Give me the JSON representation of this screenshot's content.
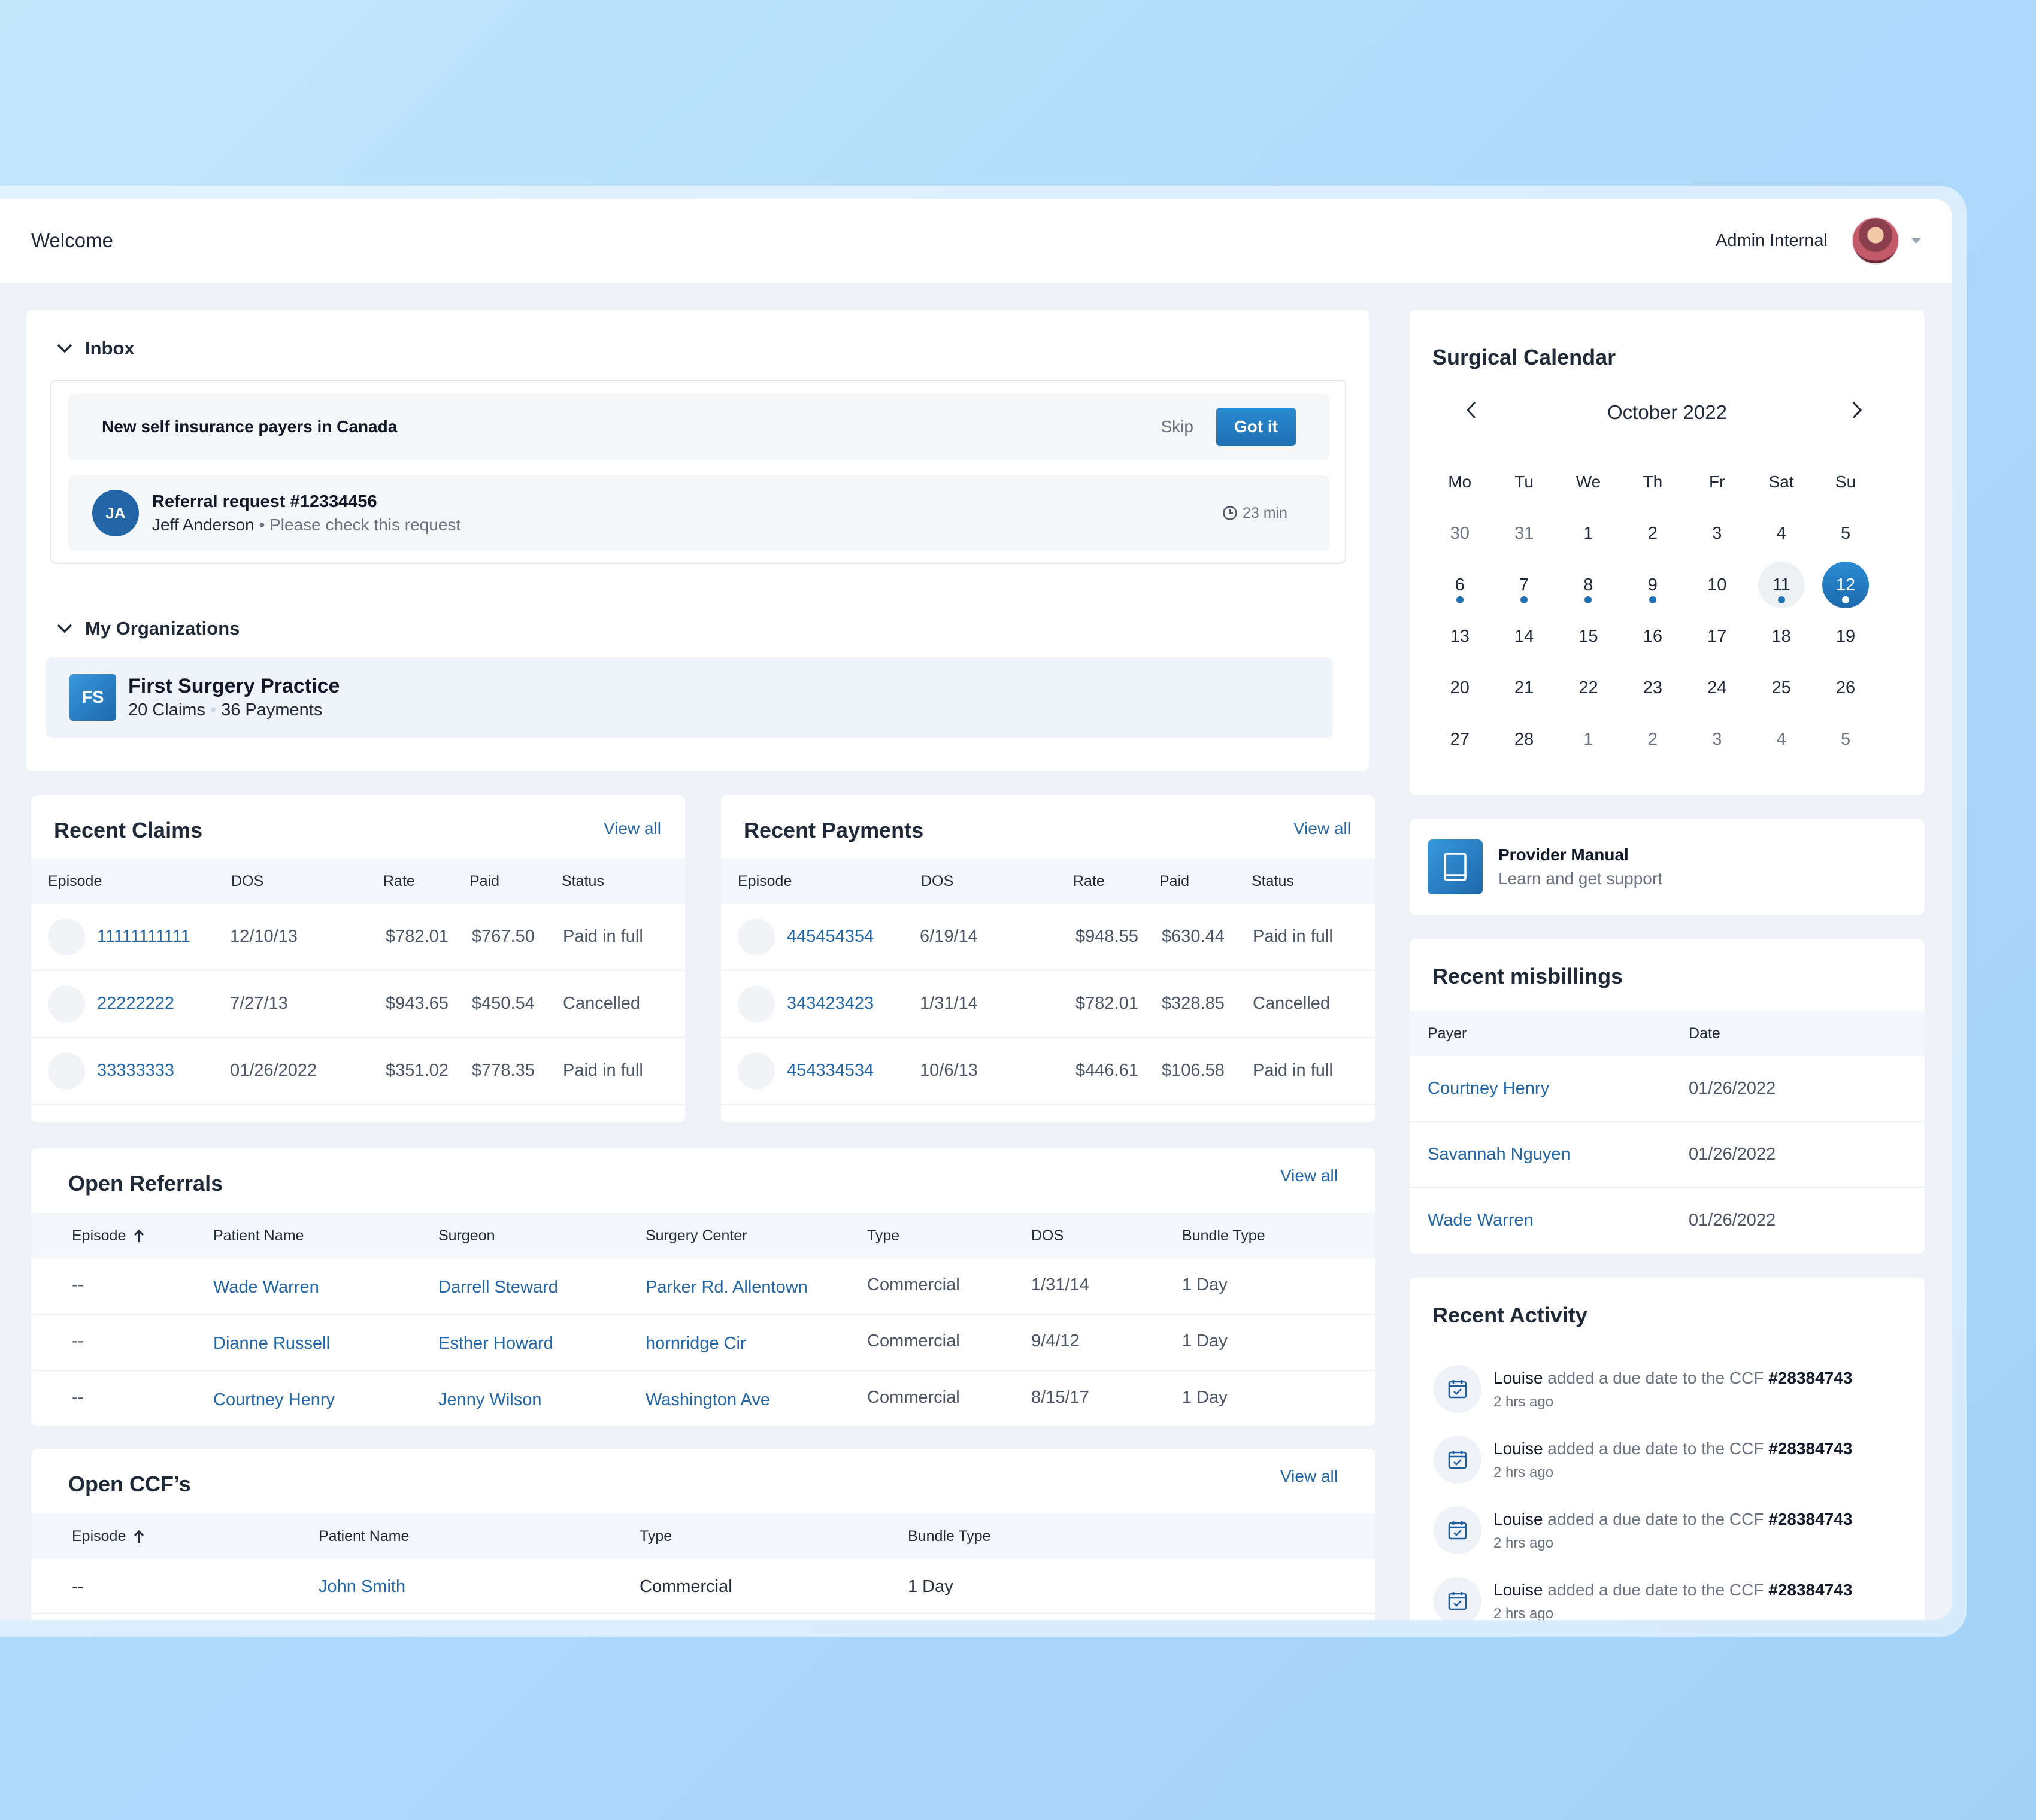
{
  "header": {
    "welcome": "Welcome",
    "user_name": "Admin Internal"
  },
  "inbox": {
    "title": "Inbox",
    "notice": {
      "text": "New self insurance payers in Canada",
      "skip": "Skip",
      "got_it": "Got it"
    },
    "request": {
      "initials": "JA",
      "title": "Referral request #12334456",
      "sender": "Jeff Anderson",
      "message": "• Please check this request",
      "time": "23 min"
    }
  },
  "organizations": {
    "title": "My Organizations",
    "org": {
      "initials": "FS",
      "name": "First Surgery Practice",
      "claims": "20 Claims",
      "sep": "•",
      "payments": "36 Payments"
    }
  },
  "recent_claims": {
    "title": "Recent Claims",
    "view_all": "View all",
    "columns": [
      "Episode",
      "DOS",
      "Rate",
      "Paid",
      "Status"
    ],
    "rows": [
      {
        "episode": "11111111111",
        "dos": "12/10/13",
        "rate": "$782.01",
        "paid": "$767.50",
        "status": "Paid in full"
      },
      {
        "episode": "22222222",
        "dos": "7/27/13",
        "rate": "$943.65",
        "paid": "$450.54",
        "status": "Cancelled"
      },
      {
        "episode": "33333333",
        "dos": "01/26/2022",
        "rate": "$351.02",
        "paid": "$778.35",
        "status": "Paid in full"
      }
    ]
  },
  "recent_payments": {
    "title": "Recent Payments",
    "view_all": "View all",
    "columns": [
      "Episode",
      "DOS",
      "Rate",
      "Paid",
      "Status"
    ],
    "rows": [
      {
        "episode": "445454354",
        "dos": "6/19/14",
        "rate": "$948.55",
        "paid": "$630.44",
        "status": "Paid in full"
      },
      {
        "episode": "343423423",
        "dos": "1/31/14",
        "rate": "$782.01",
        "paid": "$328.85",
        "status": "Cancelled"
      },
      {
        "episode": "454334534",
        "dos": "10/6/13",
        "rate": "$446.61",
        "paid": "$106.58",
        "status": "Paid in full"
      }
    ]
  },
  "open_referrals": {
    "title": "Open Referrals",
    "view_all": "View all",
    "columns": [
      "Episode",
      "Patient Name",
      "Surgeon",
      "Surgery Center",
      "Type",
      "DOS",
      "Bundle Type"
    ],
    "rows": [
      {
        "episode": "--",
        "patient": "Wade Warren",
        "surgeon": "Darrell Steward",
        "center": "Parker Rd. Allentown",
        "type": "Commercial",
        "dos": "1/31/14",
        "bundle": "1 Day"
      },
      {
        "episode": "--",
        "patient": "Dianne Russell",
        "surgeon": "Esther Howard",
        "center": "hornridge Cir",
        "type": "Commercial",
        "dos": "9/4/12",
        "bundle": "1 Day"
      },
      {
        "episode": "--",
        "patient": "Courtney Henry",
        "surgeon": "Jenny Wilson",
        "center": "Washington Ave",
        "type": "Commercial",
        "dos": "8/15/17",
        "bundle": "1 Day"
      }
    ]
  },
  "open_ccfs": {
    "title": "Open CCF’s",
    "view_all": "View all",
    "columns": [
      "Episode",
      "Patient Name",
      "Type",
      "Bundle Type"
    ],
    "rows": [
      {
        "episode": "--",
        "patient": "John Smith",
        "type": "Commercial",
        "bundle": "1 Day"
      }
    ]
  },
  "calendar": {
    "title": "Surgical Calendar",
    "month": "October 2022",
    "weekdays": [
      "Mo",
      "Tu",
      "We",
      "Th",
      "Fr",
      "Sat",
      "Su"
    ],
    "weeks": [
      [
        {
          "d": "30",
          "m": true
        },
        {
          "d": "31",
          "m": true
        },
        {
          "d": "1"
        },
        {
          "d": "2"
        },
        {
          "d": "3"
        },
        {
          "d": "4"
        },
        {
          "d": "5"
        }
      ],
      [
        {
          "d": "6",
          "dot": true
        },
        {
          "d": "7",
          "dot": true
        },
        {
          "d": "8",
          "dot": true
        },
        {
          "d": "9",
          "dot": true
        },
        {
          "d": "10"
        },
        {
          "d": "11",
          "dot": true,
          "today": true
        },
        {
          "d": "12",
          "dot": true,
          "selected": true
        }
      ],
      [
        {
          "d": "13"
        },
        {
          "d": "14"
        },
        {
          "d": "15"
        },
        {
          "d": "16"
        },
        {
          "d": "17"
        },
        {
          "d": "18"
        },
        {
          "d": "19"
        }
      ],
      [
        {
          "d": "20"
        },
        {
          "d": "21"
        },
        {
          "d": "22"
        },
        {
          "d": "23"
        },
        {
          "d": "24"
        },
        {
          "d": "25"
        },
        {
          "d": "26"
        }
      ],
      [
        {
          "d": "27"
        },
        {
          "d": "28"
        },
        {
          "d": "1",
          "m": true
        },
        {
          "d": "2",
          "m": true
        },
        {
          "d": "3",
          "m": true
        },
        {
          "d": "4",
          "m": true
        },
        {
          "d": "5",
          "m": true
        }
      ]
    ]
  },
  "provider_manual": {
    "title": "Provider Manual",
    "subtitle": "Learn and get support"
  },
  "misbillings": {
    "title": "Recent misbillings",
    "columns": [
      "Payer",
      "Date"
    ],
    "rows": [
      {
        "payer": "Courtney Henry",
        "date": "01/26/2022"
      },
      {
        "payer": "Savannah Nguyen",
        "date": "01/26/2022"
      },
      {
        "payer": "Wade Warren",
        "date": "01/26/2022"
      }
    ]
  },
  "activity": {
    "title": "Recent Activity",
    "items": [
      {
        "user": "Louise",
        "action": "added a due date to the CCF",
        "ccf": "#28384743",
        "time": "2 hrs ago"
      },
      {
        "user": "Louise",
        "action": "added a due date to the CCF",
        "ccf": "#28384743",
        "time": "2 hrs ago"
      },
      {
        "user": "Louise",
        "action": "added a due date to the CCF",
        "ccf": "#28384743",
        "time": "2 hrs ago"
      },
      {
        "user": "Louise",
        "action": "added a due date to the CCF",
        "ccf": "#28384743",
        "time": "2 hrs ago"
      }
    ]
  }
}
